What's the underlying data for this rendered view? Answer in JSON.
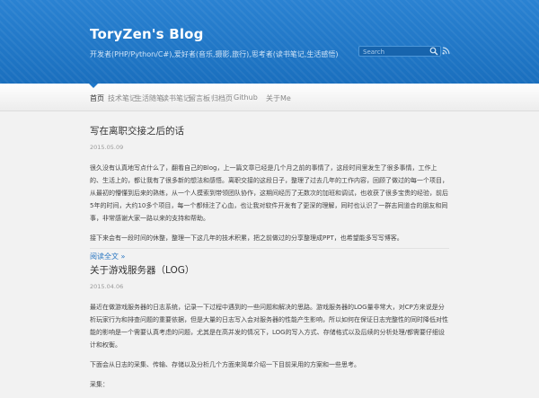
{
  "header": {
    "title": "ToryZen's Blog",
    "description": "开发者(PHP/Python/C#),爱好者(音乐,摄影,旅行),思考者(读书笔记,生活感悟)",
    "search_placeholder": "Search",
    "accent": "#1f78c9"
  },
  "nav": {
    "items": [
      {
        "label": "首页",
        "active": true
      },
      {
        "label": "技术笔记"
      },
      {
        "label": "生活随笔"
      },
      {
        "label": "读书笔记"
      },
      {
        "label": "留言板"
      },
      {
        "label": "归档页"
      },
      {
        "label": "Github"
      },
      {
        "label": "关于Me"
      }
    ]
  },
  "posts": [
    {
      "title": "写在离职交接之后的话",
      "date": "2015.05.09",
      "paragraphs": [
        "很久没有认真地写点什么了，翻看自己的Blog，上一篇文章已经是几个月之前的事情了，这段时间里发生了很多事情，工作上的、生活上的，都让我有了很多新的想法和感悟。离职交接的这段日子，整理了过去几年的工作内容，回顾了做过的每一个项目，从最初的懵懂到后来的熟练，从一个人摸索到带领团队协作，这期间经历了无数次的加班和调试，也收获了很多宝贵的经验，前后5年的时间，大约10多个项目，每一个都倾注了心血，也让我对软件开发有了更深的理解，同时也认识了一群志同道合的朋友和同事，非常感谢大家一路以来的支持和帮助。",
        "接下来会有一段时间的休整，整理一下这几年的技术积累，把之前做过的分享整理成PPT，也希望能多写写博客。"
      ],
      "read_more": "阅读全文 »"
    },
    {
      "title": "关于游戏服务器（LOG）",
      "date": "2015.04.06",
      "paragraphs": [
        "最近在做游戏服务器的日志系统，记录一下过程中遇到的一些问题和解决的思路。游戏服务器的LOG量非常大，对CP方来说是分析玩家行为和排查问题的重要依据，但是大量的日志写入会对服务器的性能产生影响，所以如何在保证日志完整性的同时降低对性能的影响是一个需要认真考虑的问题，尤其是在高并发的情况下，LOG的写入方式、存储格式以及后续的分析处理/都需要仔细设计和权衡。",
        "下面会从日志的采集、传输、存储以及分析几个方面来简单介绍一下目前采用的方案和一些思考。",
        "采集："
      ]
    }
  ]
}
